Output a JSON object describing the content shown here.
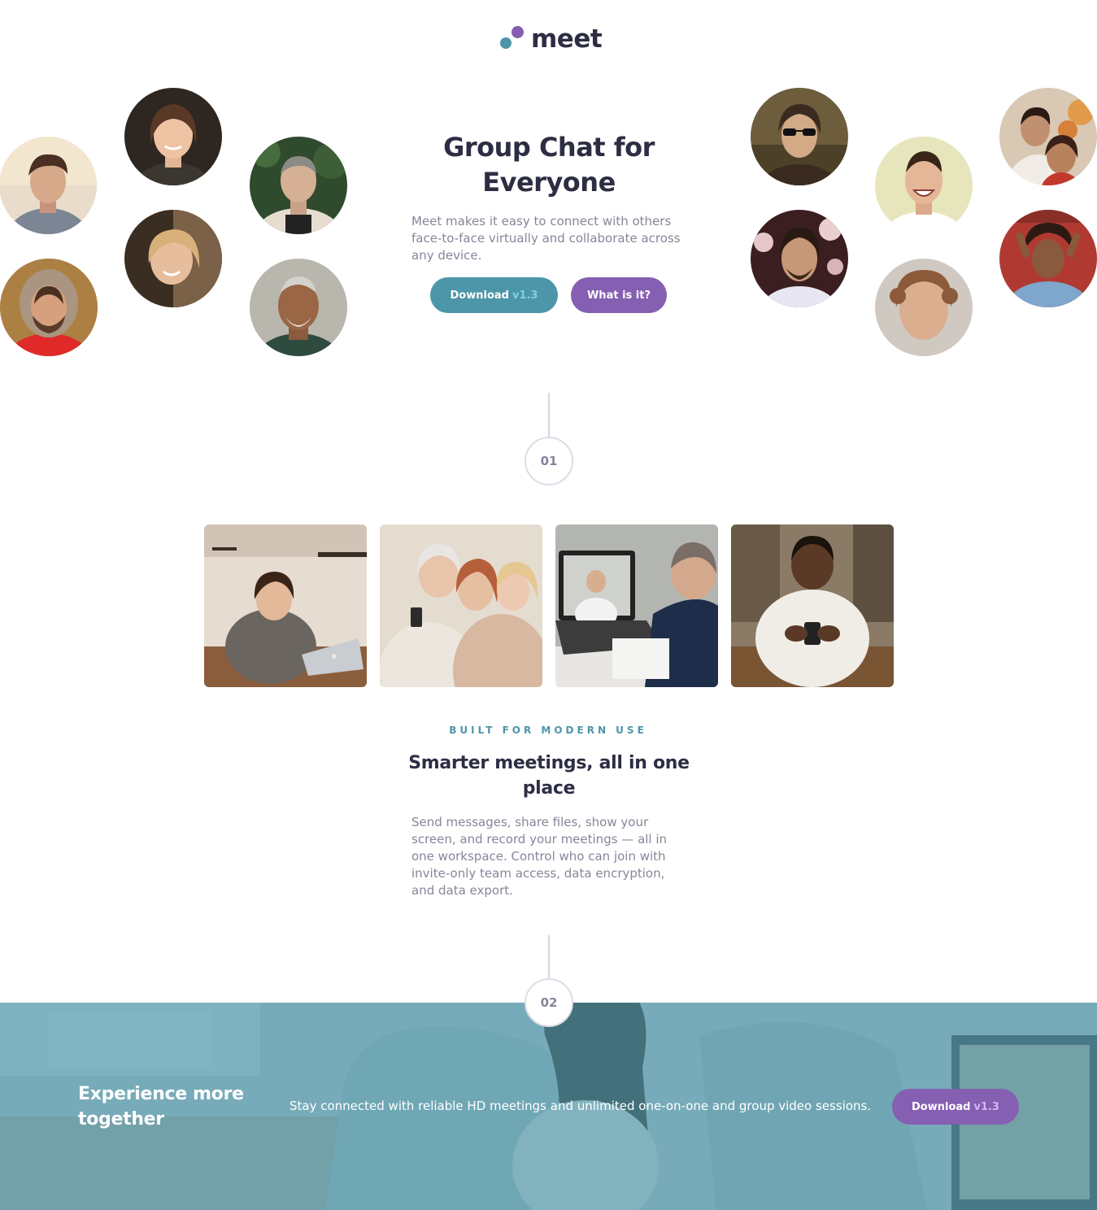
{
  "brand": {
    "name": "meet",
    "colors": {
      "teal": "#4d96a9",
      "purple": "#855fb1",
      "dark": "#2d2d44",
      "muted": "#87869a"
    }
  },
  "hero": {
    "title": "Group Chat for Everyone",
    "description": "Meet makes it easy to connect with others face-to-face virtually and collaborate across any device.",
    "primary_button": {
      "label": "Download",
      "version": "v1.3"
    },
    "secondary_button": {
      "label": "What is it?"
    }
  },
  "steps": {
    "one": "01",
    "two": "02"
  },
  "features": {
    "eyebrow": "BUILT FOR MODERN USE",
    "title": "Smarter meetings, all in one place",
    "description": "Send messages, share files, show your screen, and record your meetings — all in one workspace. Control who can join with invite-only team access, data encryption, and data export."
  },
  "cta": {
    "title": "Experience more together",
    "text": "Stay connected with reliable HD meetings and unlimited one-on-one and group video sessions.",
    "button": {
      "label": "Download",
      "version": "v1.3"
    }
  }
}
